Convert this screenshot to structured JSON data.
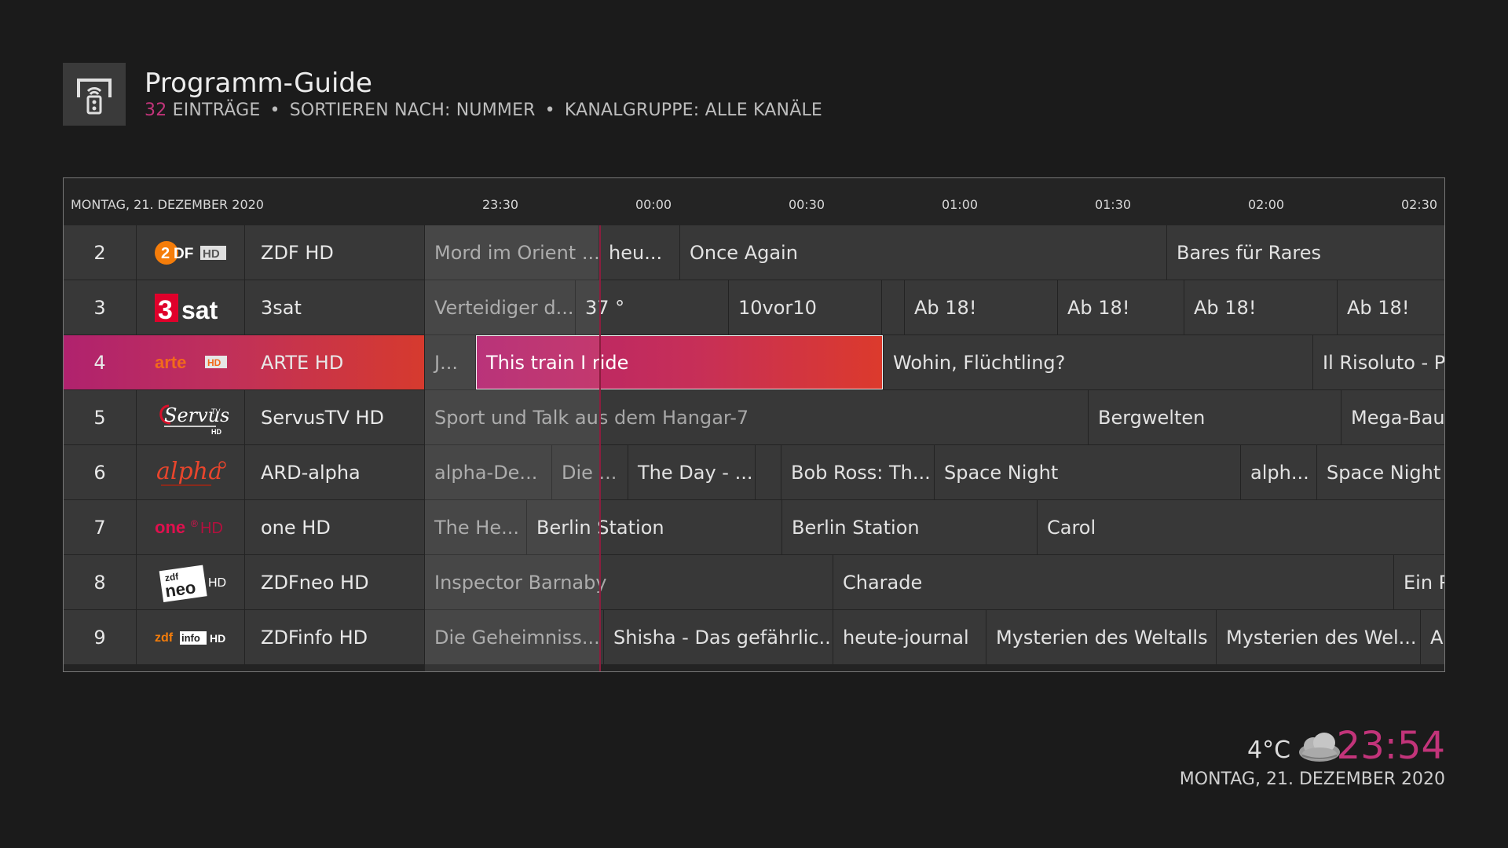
{
  "header": {
    "icon": "remote-icon",
    "title": "Programm-Guide",
    "count": "32",
    "entries_label": "EINTRÄGE",
    "sort_label": "SORTIEREN NACH: NUMMER",
    "group_label": "KANALGRUPPE: ALLE KANÄLE"
  },
  "timebar": {
    "date": "MONTAG, 21. DEZEMBER 2020",
    "ticks": [
      "23:30",
      "00:00",
      "00:30",
      "01:00",
      "01:30",
      "02:00",
      "02:30"
    ]
  },
  "channels": [
    {
      "number": "2",
      "logo": "ZDF HD",
      "name": "ZDF HD"
    },
    {
      "number": "3",
      "logo": "3sat",
      "name": "3sat"
    },
    {
      "number": "4",
      "logo": "arte HD",
      "name": "ARTE HD"
    },
    {
      "number": "5",
      "logo": "ServusTV HD",
      "name": "ServusTV HD"
    },
    {
      "number": "6",
      "logo": "alpha",
      "name": "ARD-alpha"
    },
    {
      "number": "7",
      "logo": "one HD",
      "name": "one HD"
    },
    {
      "number": "8",
      "logo": "zdf neo HD",
      "name": "ZDFneo HD"
    },
    {
      "number": "9",
      "logo": "zdf info HD",
      "name": "ZDFinfo HD"
    }
  ],
  "programs": [
    [
      "Mord im Orient ...",
      "heu...",
      "Once Again",
      "Bares für Rares"
    ],
    [
      "Verteidiger d...",
      "37 °",
      "10vor10",
      "",
      "Ab 18!",
      "Ab 18!",
      "Ab 18!",
      "Ab 18!"
    ],
    [
      "J...",
      "This train I ride",
      "Wohin, Flüchtling?",
      "Il Risoluto - Pi"
    ],
    [
      "Sport und Talk aus dem Hangar-7",
      "Bergwelten",
      "Mega-Baut"
    ],
    [
      "alpha-De...",
      "Die ...",
      "The Day - ...",
      "",
      "Bob Ross: Th...",
      "Space Night",
      "alph...",
      "Space Night"
    ],
    [
      "The He...",
      "Berlin Station",
      "Berlin Station",
      "Carol"
    ],
    [
      "Inspector Barnaby",
      "Charade",
      "Ein P"
    ],
    [
      "Die Geheimniss...",
      "Shisha - Das gefährlic...",
      "heute-journal",
      "Mysterien des Weltalls",
      "Mysterien des Wel...",
      "Al"
    ]
  ],
  "footer": {
    "temperature": "4°C",
    "weather_icon": "cloudy-icon",
    "time": "23:54",
    "date": "MONTAG, 21. DEZEMBER 2020"
  },
  "colors": {
    "accent": "#c2347a",
    "selection_start": "#b0226e",
    "selection_end": "#d63a2e",
    "background": "#1b1b1b",
    "cell": "#383838"
  }
}
